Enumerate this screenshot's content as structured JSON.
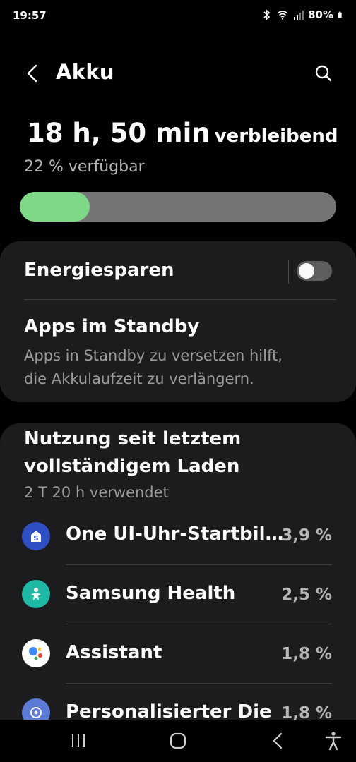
{
  "status_bar": {
    "time": "19:57",
    "battery_percent": "80%",
    "icons": [
      "bluetooth-icon",
      "wifi-icon",
      "signal-icon",
      "battery-icon"
    ]
  },
  "header": {
    "title": "Akku"
  },
  "battery": {
    "remaining_big": "18 h, 50 min",
    "remaining_suffix": "verbleibend",
    "available": "22 % verfügbar",
    "level_fraction": 0.22,
    "fill_color": "#7ed887"
  },
  "settings": {
    "power_saving_label": "Energiesparen",
    "power_saving_on": false,
    "standby_title": "Apps im Standby",
    "standby_desc_line1": "Apps in Standby zu versetzen hilft,",
    "standby_desc_line2": "die Akkulaufzeit zu verlängern."
  },
  "usage": {
    "title_line1": "Nutzung seit letztem",
    "title_line2": "vollständigem Laden",
    "subtitle": "2 T 20 h verwendet",
    "apps": [
      {
        "name": "One UI-Uhr-Startbil...",
        "percent": "3,9 %",
        "icon": "one-ui-clock-icon",
        "color": "#2f4fc4"
      },
      {
        "name": "Samsung Health",
        "percent": "2,5 %",
        "icon": "samsung-health-icon",
        "color": "#1fb8a4"
      },
      {
        "name": "Assistant",
        "percent": "1,8 %",
        "icon": "google-assistant-icon",
        "color": "#ffffff"
      },
      {
        "name": "Personalisierter Die",
        "percent": "1,8 %",
        "icon": "personalized-service-icon",
        "color": "#5b7bd6"
      }
    ]
  },
  "nav": {
    "buttons": [
      "recents-button",
      "home-button",
      "back-button",
      "accessibility-button"
    ]
  }
}
